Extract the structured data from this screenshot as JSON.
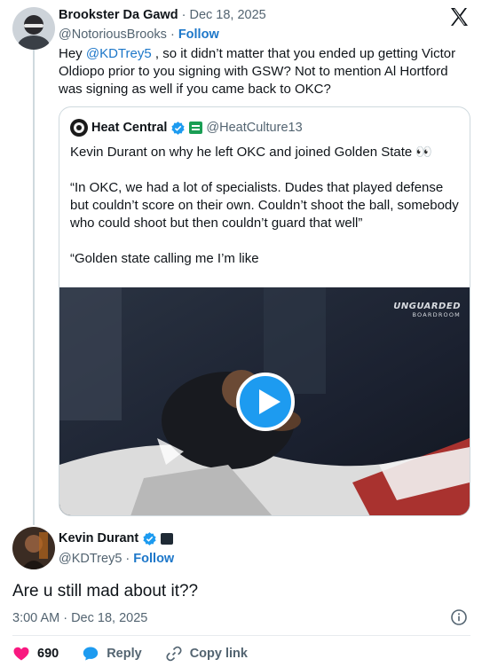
{
  "reply_tweet": {
    "display_name": "Brookster Da Gawd",
    "separator": "·",
    "date": "Dec 18, 2025",
    "handle": "@NotoriousBrooks",
    "follow_label": "Follow",
    "text_before": "Hey ",
    "mention": "@KDTrey5",
    "text_after": " , so it didn’t matter that you ended up getting Victor Oldiopo prior to you signing with GSW? Not to mention Al Hortford was signing as well if you came back to OKC?"
  },
  "quoted_tweet": {
    "display_name": "Heat Central",
    "handle": "@HeatCulture13",
    "line1": "Kevin Durant on why he left OKC and joined Golden State 👀",
    "line2": "“In OKC, we had a lot of specialists. Dudes that played defense but couldn’t score on their own. Couldn’t shoot the ball, somebody who could shoot but then couldn’t guard that well”",
    "line3": "“Golden state calling me I’m like",
    "video_watermark_title": "UNGUARDED",
    "video_watermark_subtitle": "BOARDROOM"
  },
  "main_tweet": {
    "display_name": "Kevin Durant",
    "handle": "@KDTrey5",
    "separator": "·",
    "follow_label": "Follow",
    "text": "Are u still mad about it??",
    "timestamp": "3:00 AM · Dec 18, 2025"
  },
  "actions": {
    "like_count": "690",
    "reply_label": "Reply",
    "copy_link_label": "Copy link"
  },
  "colors": {
    "link": "#1d77c9",
    "verified": "#1d9bf0",
    "like": "#f91880",
    "muted": "#536471"
  },
  "icons": [
    "x-logo-icon",
    "verified-icon",
    "play-icon",
    "info-icon",
    "heart-icon",
    "reply-bubble-icon",
    "link-icon"
  ]
}
